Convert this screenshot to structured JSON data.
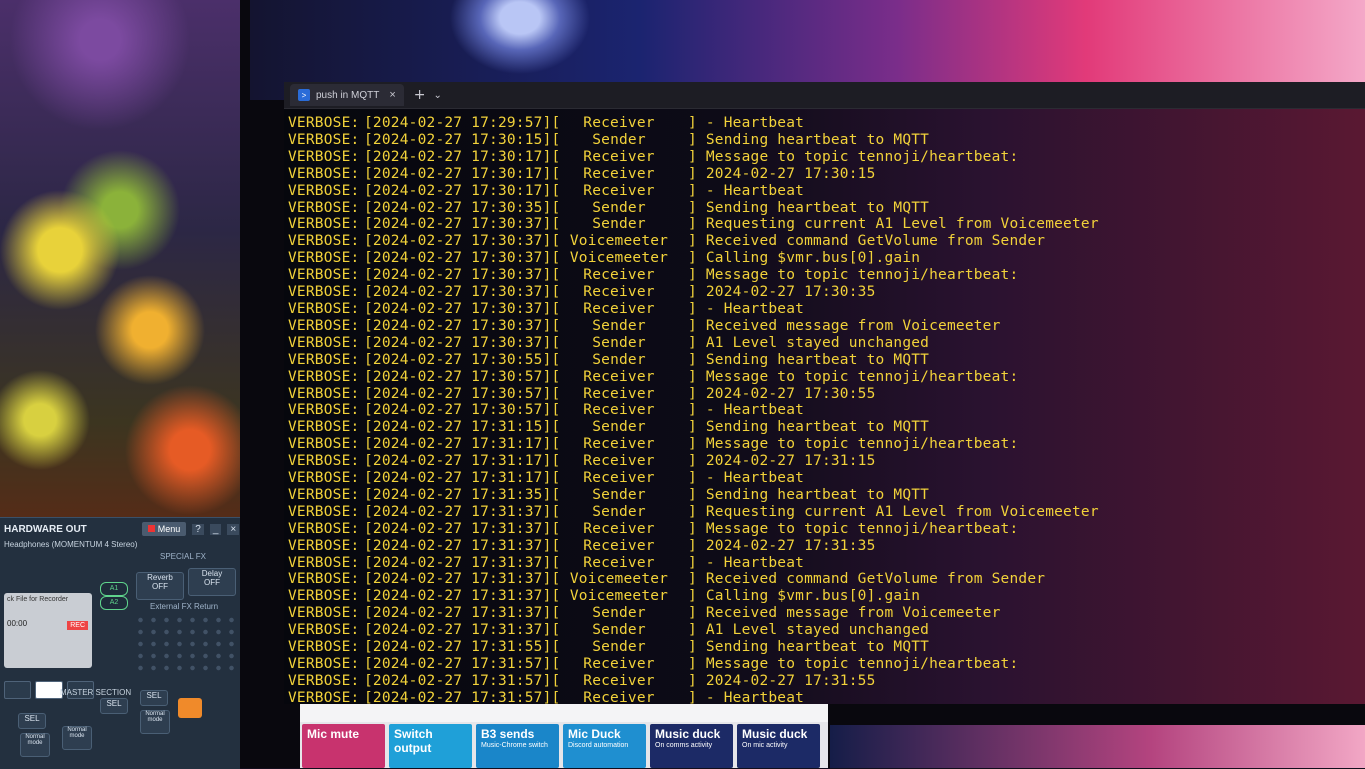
{
  "terminal": {
    "tab_title": "push in MQTT",
    "tab_icon": "powershell-icon",
    "new_tab_glyph": "+",
    "dropdown_glyph": "⌄",
    "close_glyph": "×",
    "lines": [
      [
        "VERBOSE:",
        "[2024-02-27 17:29:57][",
        "Receiver",
        "] - Heartbeat"
      ],
      [
        "VERBOSE:",
        "[2024-02-27 17:30:15][",
        "Sender",
        "] Sending heartbeat to MQTT"
      ],
      [
        "VERBOSE:",
        "[2024-02-27 17:30:17][",
        "Receiver",
        "] Message to topic tennoji/heartbeat:"
      ],
      [
        "VERBOSE:",
        "[2024-02-27 17:30:17][",
        "Receiver",
        "] 2024-02-27 17:30:15"
      ],
      [
        "VERBOSE:",
        "[2024-02-27 17:30:17][",
        "Receiver",
        "] - Heartbeat"
      ],
      [
        "VERBOSE:",
        "[2024-02-27 17:30:35][",
        "Sender",
        "] Sending heartbeat to MQTT"
      ],
      [
        "VERBOSE:",
        "[2024-02-27 17:30:37][",
        "Sender",
        "] Requesting current A1 Level from Voicemeeter"
      ],
      [
        "VERBOSE:",
        "[2024-02-27 17:30:37][",
        "Voicemeeter",
        "] Received command GetVolume from Sender"
      ],
      [
        "VERBOSE:",
        "[2024-02-27 17:30:37][",
        "Voicemeeter",
        "] Calling $vmr.bus[0].gain"
      ],
      [
        "VERBOSE:",
        "[2024-02-27 17:30:37][",
        "Receiver",
        "] Message to topic tennoji/heartbeat:"
      ],
      [
        "VERBOSE:",
        "[2024-02-27 17:30:37][",
        "Receiver",
        "] 2024-02-27 17:30:35"
      ],
      [
        "VERBOSE:",
        "[2024-02-27 17:30:37][",
        "Receiver",
        "] - Heartbeat"
      ],
      [
        "VERBOSE:",
        "[2024-02-27 17:30:37][",
        "Sender",
        "] Received message from Voicemeeter"
      ],
      [
        "VERBOSE:",
        "[2024-02-27 17:30:37][",
        "Sender",
        "] A1 Level stayed unchanged"
      ],
      [
        "VERBOSE:",
        "[2024-02-27 17:30:55][",
        "Sender",
        "] Sending heartbeat to MQTT"
      ],
      [
        "VERBOSE:",
        "[2024-02-27 17:30:57][",
        "Receiver",
        "] Message to topic tennoji/heartbeat:"
      ],
      [
        "VERBOSE:",
        "[2024-02-27 17:30:57][",
        "Receiver",
        "] 2024-02-27 17:30:55"
      ],
      [
        "VERBOSE:",
        "[2024-02-27 17:30:57][",
        "Receiver",
        "] - Heartbeat"
      ],
      [
        "VERBOSE:",
        "[2024-02-27 17:31:15][",
        "Sender",
        "] Sending heartbeat to MQTT"
      ],
      [
        "VERBOSE:",
        "[2024-02-27 17:31:17][",
        "Receiver",
        "] Message to topic tennoji/heartbeat:"
      ],
      [
        "VERBOSE:",
        "[2024-02-27 17:31:17][",
        "Receiver",
        "] 2024-02-27 17:31:15"
      ],
      [
        "VERBOSE:",
        "[2024-02-27 17:31:17][",
        "Receiver",
        "] - Heartbeat"
      ],
      [
        "VERBOSE:",
        "[2024-02-27 17:31:35][",
        "Sender",
        "] Sending heartbeat to MQTT"
      ],
      [
        "VERBOSE:",
        "[2024-02-27 17:31:37][",
        "Sender",
        "] Requesting current A1 Level from Voicemeeter"
      ],
      [
        "VERBOSE:",
        "[2024-02-27 17:31:37][",
        "Receiver",
        "] Message to topic tennoji/heartbeat:"
      ],
      [
        "VERBOSE:",
        "[2024-02-27 17:31:37][",
        "Receiver",
        "] 2024-02-27 17:31:35"
      ],
      [
        "VERBOSE:",
        "[2024-02-27 17:31:37][",
        "Receiver",
        "] - Heartbeat"
      ],
      [
        "VERBOSE:",
        "[2024-02-27 17:31:37][",
        "Voicemeeter",
        "] Received command GetVolume from Sender"
      ],
      [
        "VERBOSE:",
        "[2024-02-27 17:31:37][",
        "Voicemeeter",
        "] Calling $vmr.bus[0].gain"
      ],
      [
        "VERBOSE:",
        "[2024-02-27 17:31:37][",
        "Sender",
        "] Received message from Voicemeeter"
      ],
      [
        "VERBOSE:",
        "[2024-02-27 17:31:37][",
        "Sender",
        "] A1 Level stayed unchanged"
      ],
      [
        "VERBOSE:",
        "[2024-02-27 17:31:55][",
        "Sender",
        "] Sending heartbeat to MQTT"
      ],
      [
        "VERBOSE:",
        "[2024-02-27 17:31:57][",
        "Receiver",
        "] Message to topic tennoji/heartbeat:"
      ],
      [
        "VERBOSE:",
        "[2024-02-27 17:31:57][",
        "Receiver",
        "] 2024-02-27 17:31:55"
      ],
      [
        "VERBOSE:",
        "[2024-02-27 17:31:57][",
        "Receiver",
        "] - Heartbeat"
      ]
    ],
    "text_color": "#f2d23a"
  },
  "voicemeeter": {
    "hardware_out": "HARDWARE OUT",
    "device": "Headphones (MOMENTUM 4 Stereo)",
    "menu_label": "Menu",
    "help_glyph": "?",
    "minimize_glyph": "_",
    "close_glyph": "×",
    "special_fx": "SPECIAL FX",
    "reverb": "Reverb",
    "reverb_state": "OFF",
    "delay": "Delay",
    "delay_state": "OFF",
    "external_fx": "External FX Return",
    "slot_line1": "ck File for Recorder",
    "slot_time": "00:00",
    "rec_label": "REC",
    "bus_a1": "A1",
    "bus_a2": "A2",
    "master_section": "MASTER SECTION",
    "sel": "SEL",
    "normal_mode": "Normal mode"
  },
  "deck": {
    "buttons": [
      {
        "title": "Mic mute",
        "sub": "",
        "color": "#c8336e"
      },
      {
        "title": "Switch output",
        "sub": "",
        "color": "#1fa0d8"
      },
      {
        "title": "B3 sends",
        "sub": "Music-Chrome switch",
        "color": "#1a86c9"
      },
      {
        "title": "Mic Duck",
        "sub": "Discord automation",
        "color": "#1f8fd0"
      },
      {
        "title": "Music duck",
        "sub": "On comms activity",
        "color": "#1c2a66"
      },
      {
        "title": "Music duck",
        "sub": "On mic activity",
        "color": "#1c2a66"
      }
    ]
  }
}
